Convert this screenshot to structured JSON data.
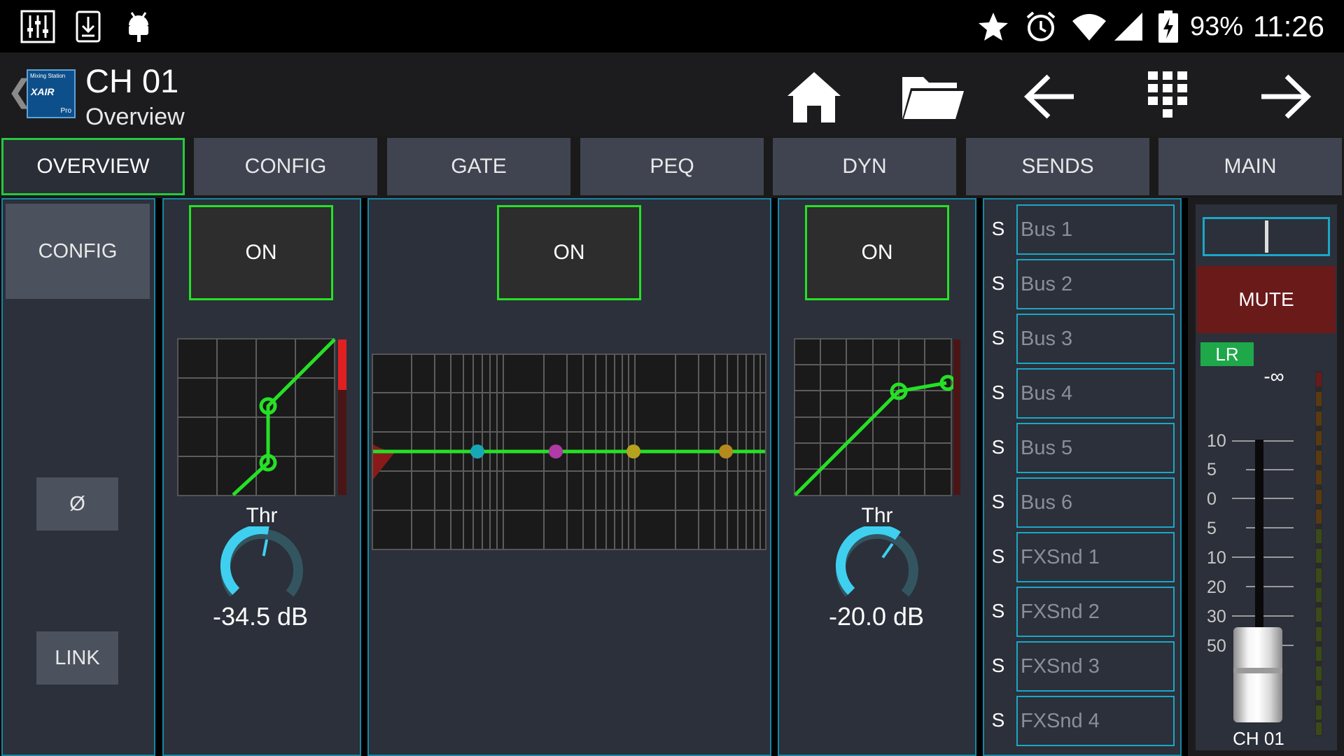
{
  "status_bar": {
    "icons": [
      "mixer-icon",
      "download-icon",
      "android-debug-icon",
      "star-icon",
      "alarm-icon",
      "wifi-icon",
      "signal-icon",
      "battery-charging-icon"
    ],
    "battery": "93%",
    "time": "11:26"
  },
  "header": {
    "back_glyph": "❮",
    "app_logo": {
      "lines": [
        "Mixing Station",
        "XAIR",
        "Pro"
      ]
    },
    "title": "CH 01",
    "subtitle": "Overview",
    "nav_icons": [
      "home-icon",
      "folder-icon",
      "arrow-left-icon",
      "grid-icon",
      "arrow-right-icon"
    ]
  },
  "tabs": [
    {
      "label": "OVERVIEW",
      "active": true
    },
    {
      "label": "CONFIG",
      "active": false
    },
    {
      "label": "GATE",
      "active": false
    },
    {
      "label": "PEQ",
      "active": false
    },
    {
      "label": "DYN",
      "active": false
    },
    {
      "label": "SENDS",
      "active": false
    },
    {
      "label": "MAIN",
      "active": false
    }
  ],
  "config_panel": {
    "config_label": "CONFIG",
    "phase_label": "Ø",
    "link_label": "LINK"
  },
  "gate_panel": {
    "on_label": "ON",
    "knob_label": "Thr",
    "value": "-34.5 dB",
    "knob_fraction": 0.54
  },
  "peq_panel": {
    "on_label": "ON",
    "band_colors": [
      "#18a7b5",
      "#b03aa6",
      "#b4a21f",
      "#b48a1f"
    ]
  },
  "dyn_panel": {
    "on_label": "ON",
    "knob_label": "Thr",
    "value": "-20.0 dB",
    "knob_fraction": 0.63
  },
  "sends": {
    "solo_label": "S",
    "items": [
      "Bus 1",
      "Bus 2",
      "Bus 3",
      "Bus 4",
      "Bus 5",
      "Bus 6",
      "FXSnd 1",
      "FXSnd 2",
      "FXSnd 3",
      "FXSnd 4"
    ]
  },
  "main_panel": {
    "mute_label": "MUTE",
    "lr_label": "LR",
    "level_value": "-∞",
    "scale": [
      "10",
      "5",
      "0",
      "5",
      "10",
      "20",
      "30",
      "50"
    ],
    "channel_name": "CH 01",
    "colors": {
      "mute": "#6b1a1a",
      "lr": "#1fa84a"
    }
  },
  "colors": {
    "active_green": "#27c93f",
    "panel_border": "#1787a6",
    "knob_cyan": "#3fd0f0"
  }
}
